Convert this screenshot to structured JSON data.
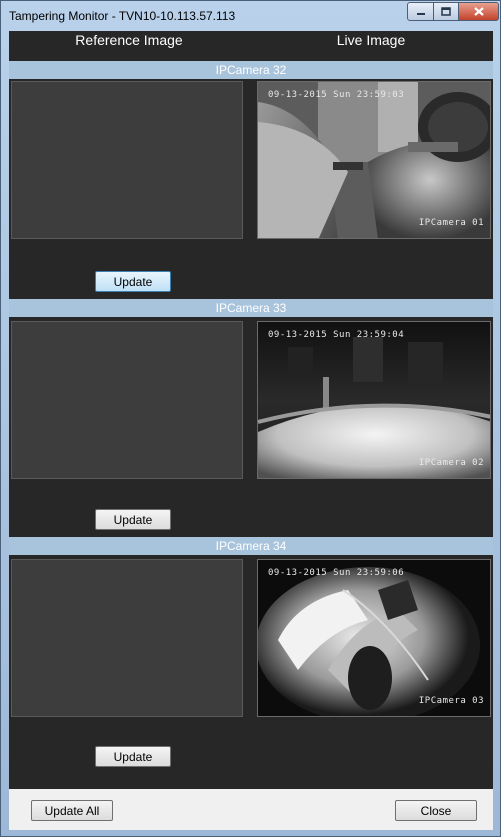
{
  "window": {
    "title": "Tampering Monitor - TVN10-10.113.57.113"
  },
  "columns": {
    "reference": "Reference Image",
    "live": "Live Image"
  },
  "cameras": [
    {
      "name": "IPCamera 32",
      "timestamp": "09-13-2015 Sun 23:59:03",
      "overlay": "IPCamera 01",
      "update_label": "Update"
    },
    {
      "name": "IPCamera 33",
      "timestamp": "09-13-2015 Sun 23:59:04",
      "overlay": "IPCamera 02",
      "update_label": "Update"
    },
    {
      "name": "IPCamera 34",
      "timestamp": "09-13-2015 Sun 23:59:06",
      "overlay": "IPCamera 03",
      "update_label": "Update"
    }
  ],
  "footer": {
    "update_all_label": "Update All",
    "close_label": "Close"
  },
  "icons": {
    "minimize": "minimize-icon",
    "maximize": "maximize-icon",
    "close": "close-icon"
  },
  "colors": {
    "camera_header": "#a8c3dc",
    "panel_bg": "#272727",
    "close_button": "#c4422b"
  }
}
